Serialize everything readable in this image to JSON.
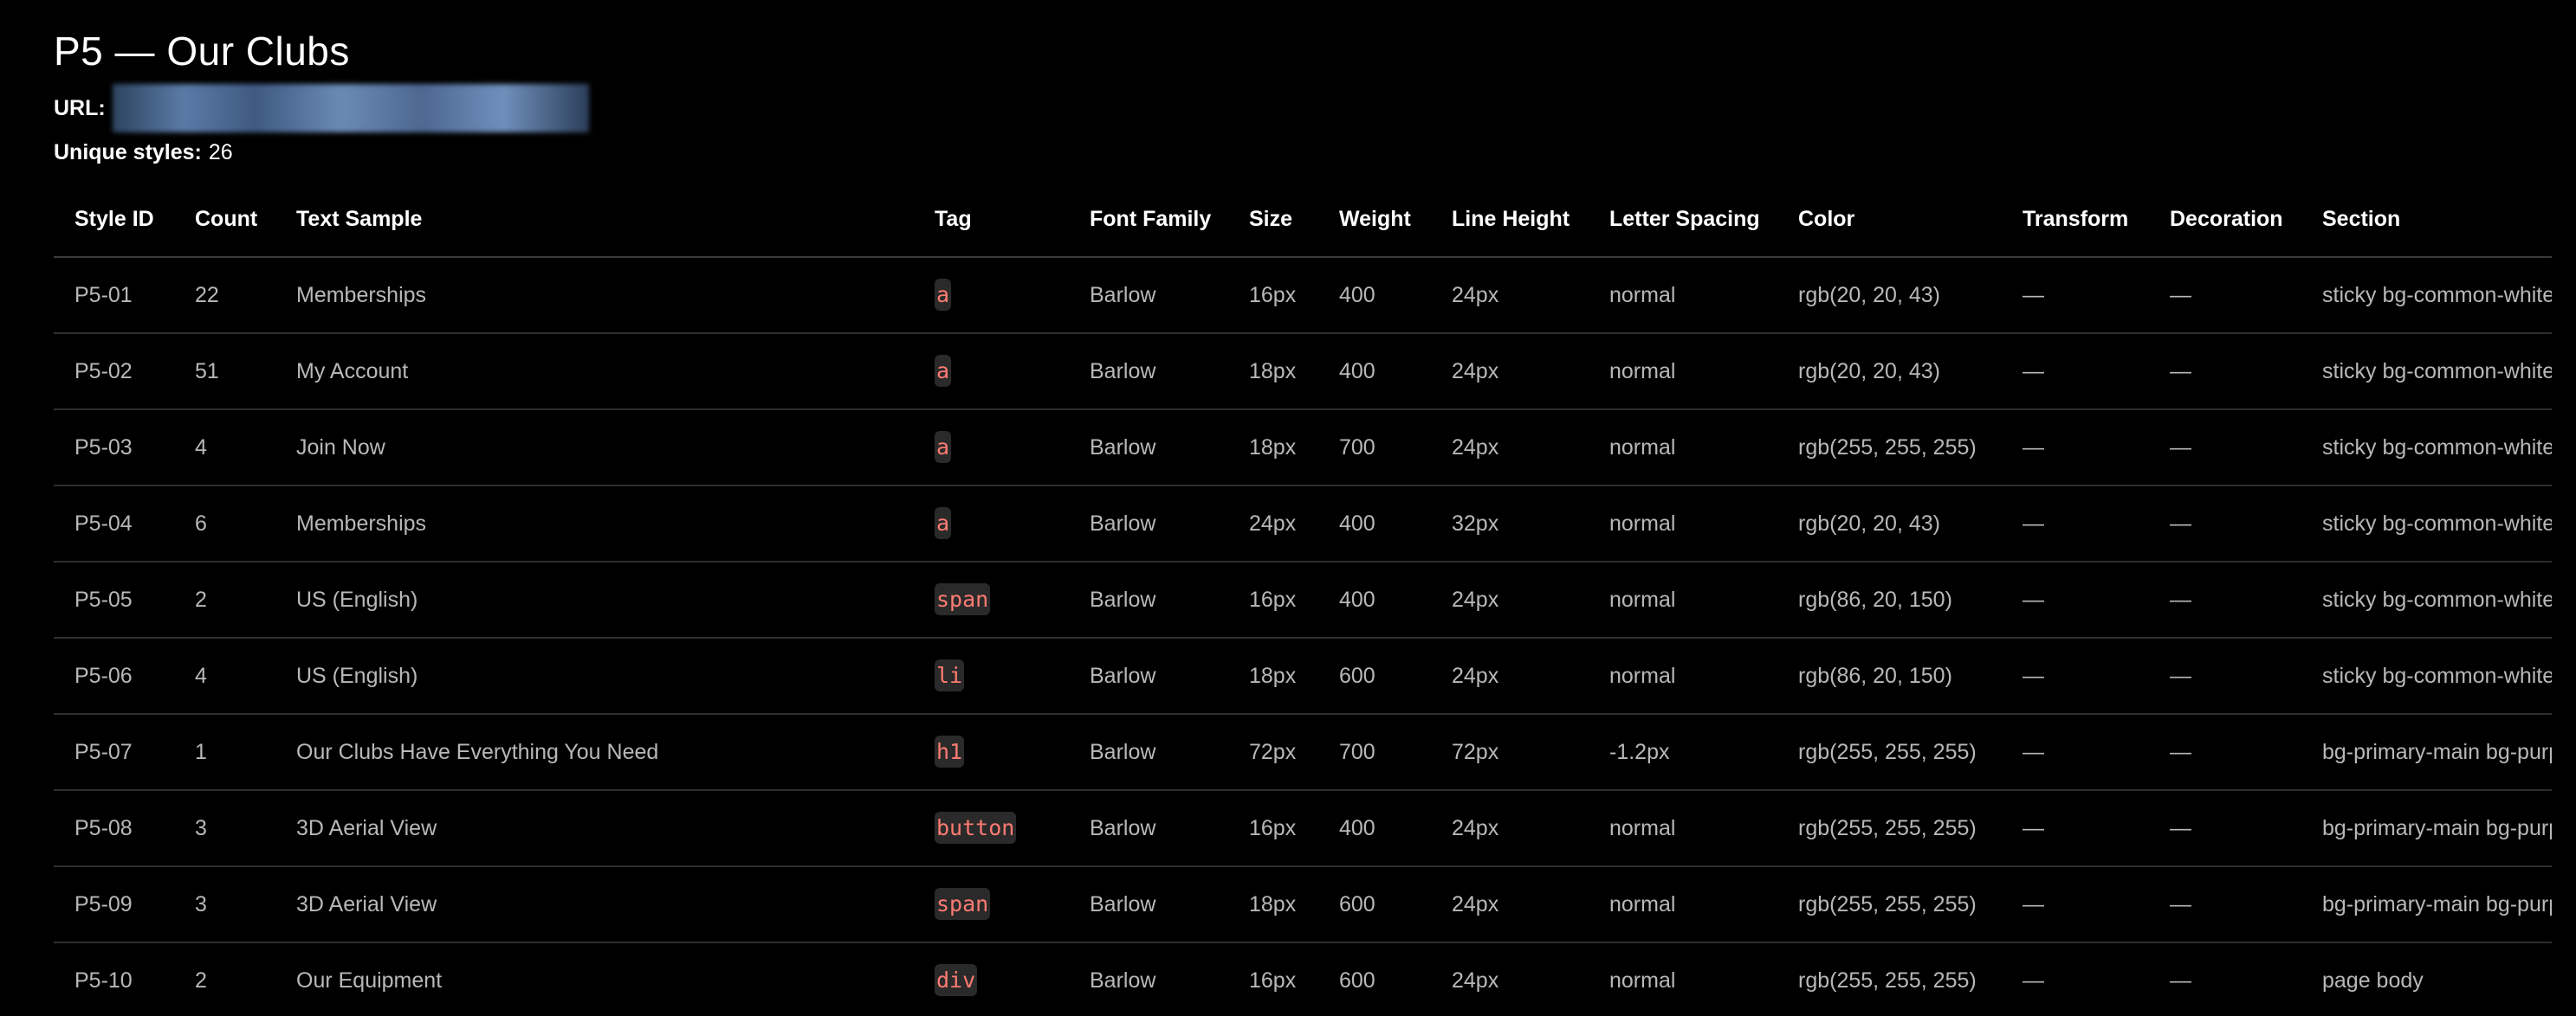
{
  "page": {
    "title": "P5 — Our Clubs",
    "url_label": "URL:",
    "unique_label": "Unique styles:",
    "unique_count": "26"
  },
  "table": {
    "headers": [
      "Style ID",
      "Count",
      "Text Sample",
      "Tag",
      "Font Family",
      "Size",
      "Weight",
      "Line Height",
      "Letter Spacing",
      "Color",
      "Transform",
      "Decoration",
      "Section"
    ],
    "rows": [
      [
        "P5-01",
        "22",
        "Memberships",
        "a",
        "Barlow",
        "16px",
        "400",
        "24px",
        "normal",
        "rgb(20, 20, 43)",
        "—",
        "—",
        "sticky bg-common-white"
      ],
      [
        "P5-02",
        "51",
        "My Account",
        "a",
        "Barlow",
        "18px",
        "400",
        "24px",
        "normal",
        "rgb(20, 20, 43)",
        "—",
        "—",
        "sticky bg-common-white"
      ],
      [
        "P5-03",
        "4",
        "Join Now",
        "a",
        "Barlow",
        "18px",
        "700",
        "24px",
        "normal",
        "rgb(255, 255, 255)",
        "—",
        "—",
        "sticky bg-common-white"
      ],
      [
        "P5-04",
        "6",
        "Memberships",
        "a",
        "Barlow",
        "24px",
        "400",
        "32px",
        "normal",
        "rgb(20, 20, 43)",
        "—",
        "—",
        "sticky bg-common-white"
      ],
      [
        "P5-05",
        "2",
        "US (English)",
        "span",
        "Barlow",
        "16px",
        "400",
        "24px",
        "normal",
        "rgb(86, 20, 150)",
        "—",
        "—",
        "sticky bg-common-white"
      ],
      [
        "P5-06",
        "4",
        "US (English)",
        "li",
        "Barlow",
        "18px",
        "600",
        "24px",
        "normal",
        "rgb(86, 20, 150)",
        "—",
        "—",
        "sticky bg-common-white"
      ],
      [
        "P5-07",
        "1",
        "Our Clubs Have Everything You Need",
        "h1",
        "Barlow",
        "72px",
        "700",
        "72px",
        "-1.2px",
        "rgb(255, 255, 255)",
        "—",
        "—",
        "bg-primary-main bg-purpl"
      ],
      [
        "P5-08",
        "3",
        "3D Aerial View",
        "button",
        "Barlow",
        "16px",
        "400",
        "24px",
        "normal",
        "rgb(255, 255, 255)",
        "—",
        "—",
        "bg-primary-main bg-purpl"
      ],
      [
        "P5-09",
        "3",
        "3D Aerial View",
        "span",
        "Barlow",
        "18px",
        "600",
        "24px",
        "normal",
        "rgb(255, 255, 255)",
        "—",
        "—",
        "bg-primary-main bg-purpl"
      ],
      [
        "P5-10",
        "2",
        "Our Equipment",
        "div",
        "Barlow",
        "16px",
        "600",
        "24px",
        "normal",
        "rgb(255, 255, 255)",
        "—",
        "—",
        "page body"
      ]
    ]
  }
}
